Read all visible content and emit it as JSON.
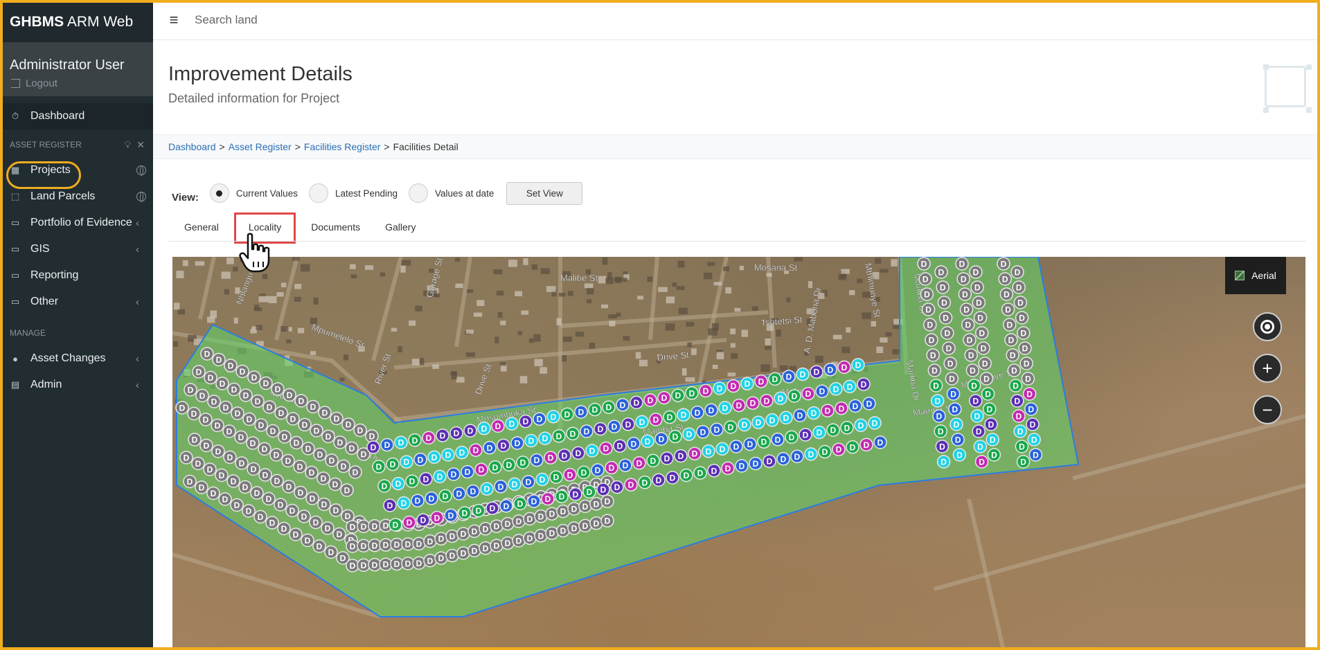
{
  "app": {
    "brand_bold": "GHBMS",
    "brand_rest": " ARM Web"
  },
  "user": {
    "name": "Administrator User",
    "logout": "Logout"
  },
  "sidebar": {
    "dashboard": "Dashboard",
    "section_asset_register": "ASSET REGISTER",
    "items": [
      {
        "label": "Projects",
        "icon": "building-icon"
      },
      {
        "label": "Land Parcels",
        "icon": "parcel-icon"
      },
      {
        "label": "Portfolio of Evidence",
        "icon": "book-icon"
      },
      {
        "label": "GIS",
        "icon": "book-icon"
      },
      {
        "label": "Reporting",
        "icon": "book-icon"
      },
      {
        "label": "Other",
        "icon": "book-icon"
      }
    ],
    "section_manage": "MANAGE",
    "manage_items": [
      {
        "label": "Asset Changes",
        "icon": "pin-icon"
      },
      {
        "label": "Admin",
        "icon": "clipboard-icon"
      }
    ]
  },
  "topbar": {
    "search_placeholder": "Search land"
  },
  "header": {
    "title": "Improvement Details",
    "subtitle": "Detailed information for Project"
  },
  "breadcrumb": {
    "items": [
      "Dashboard",
      "Asset Register",
      "Facilities Register"
    ],
    "current": "Facilities Detail",
    "separator": ">"
  },
  "view": {
    "label": "View:",
    "options": [
      "Current Values",
      "Latest Pending",
      "Values at date"
    ],
    "selected": "Current Values",
    "button": "Set View"
  },
  "tabs": {
    "items": [
      "General",
      "Locality",
      "Documents",
      "Gallery"
    ],
    "active": "Locality"
  },
  "map": {
    "layer_button": "Aerial",
    "marker_letter": "D",
    "street_labels": [
      "Malibe St",
      "Mpumelelo St",
      "Nhlangu Coal",
      "Garage St",
      "River St",
      "Drive St",
      "Drive St",
      "Mosumbuka St",
      "Mamba St",
      "Mamba St",
      "Mamba St",
      "A. D. Mabona Dr",
      "A. D. Mabona Dr",
      "Tsotetsi St",
      "Mafa St",
      "Mthimunye St",
      "Mthimunye St",
      "Madiba Dr",
      "Madiba Dr",
      "Mosana St"
    ],
    "colors": {
      "polygon_fill": "#5fd86a",
      "polygon_stroke": "#2a7de1",
      "marker_existing": "#7a7a7a",
      "marker_green": "#1aa84a",
      "marker_cyan": "#1fd3e6",
      "marker_blue": "#2a62d9",
      "marker_purple": "#5b2fb3",
      "marker_magenta": "#c22bb0"
    }
  },
  "colors": {
    "sidebar_bg": "#222d32",
    "accent": "#f0ad1e",
    "active_tab_border": "#e04848",
    "link": "#2a6fb7"
  }
}
